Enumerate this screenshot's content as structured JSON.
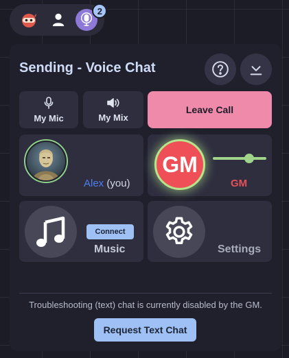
{
  "toolbar": {
    "items": [
      {
        "icon": "ninja-icon",
        "color": "#e05a4b"
      },
      {
        "icon": "user-icon",
        "color": "#ffffff"
      },
      {
        "icon": "podcast-icon",
        "color": "#8e79d6",
        "badge": "2"
      }
    ]
  },
  "panel": {
    "title": "Sending - Voice Chat",
    "help_icon": "question-icon",
    "collapse_icon": "collapse-down-icon"
  },
  "controls": {
    "mic_label": "My Mic",
    "mic_icon": "microphone-icon",
    "mix_label": "My Mix",
    "mix_icon": "speaker-icon",
    "leave_label": "Leave Call",
    "leave_color": "#f08aab"
  },
  "participants": [
    {
      "name": "Alex",
      "suffix": "(you)",
      "name_color": "#4f7ef0"
    },
    {
      "name": "GM",
      "initials": "GM",
      "avatar_color": "#ef4f56",
      "ring_color": "#b7e58c",
      "volume": 0.68
    }
  ],
  "music": {
    "label": "Music",
    "connect_label": "Connect",
    "icon": "music-note-icon"
  },
  "settings": {
    "label": "Settings",
    "icon": "gear-icon"
  },
  "footer": {
    "message": "Troubleshooting (text) chat is currently disabled by the GM.",
    "request_label": "Request Text Chat",
    "accent": "#9ec0f4"
  }
}
